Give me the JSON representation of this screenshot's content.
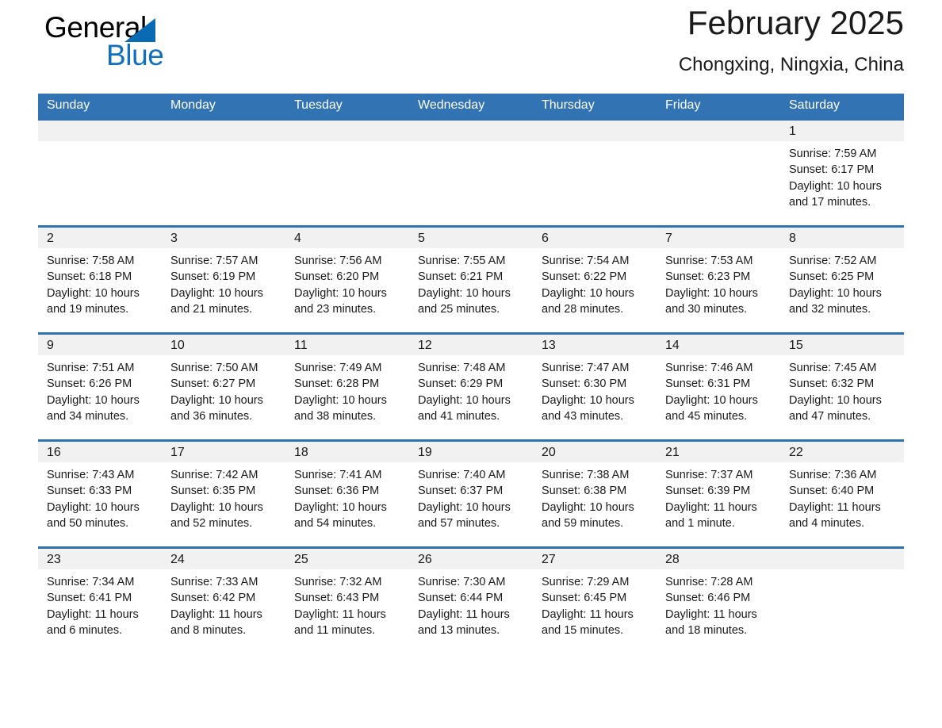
{
  "brand": {
    "name_part1": "General",
    "name_part2": "Blue",
    "triangle_color": "#0a6bb5",
    "blue_color": "#0f6fc0"
  },
  "header": {
    "title": "February 2025",
    "subtitle": "Chongxing, Ningxia, China"
  },
  "theme": {
    "header_blue": "#3273b3",
    "row_rule_blue": "#2f72b2",
    "daynum_band": "#f1f1f1"
  },
  "weekdays": [
    "Sunday",
    "Monday",
    "Tuesday",
    "Wednesday",
    "Thursday",
    "Friday",
    "Saturday"
  ],
  "weeks": [
    [
      {
        "day": "",
        "sunrise": "",
        "sunset": "",
        "daylight1": "",
        "daylight2": ""
      },
      {
        "day": "",
        "sunrise": "",
        "sunset": "",
        "daylight1": "",
        "daylight2": ""
      },
      {
        "day": "",
        "sunrise": "",
        "sunset": "",
        "daylight1": "",
        "daylight2": ""
      },
      {
        "day": "",
        "sunrise": "",
        "sunset": "",
        "daylight1": "",
        "daylight2": ""
      },
      {
        "day": "",
        "sunrise": "",
        "sunset": "",
        "daylight1": "",
        "daylight2": ""
      },
      {
        "day": "",
        "sunrise": "",
        "sunset": "",
        "daylight1": "",
        "daylight2": ""
      },
      {
        "day": "1",
        "sunrise": "Sunrise: 7:59 AM",
        "sunset": "Sunset: 6:17 PM",
        "daylight1": "Daylight: 10 hours",
        "daylight2": "and 17 minutes."
      }
    ],
    [
      {
        "day": "2",
        "sunrise": "Sunrise: 7:58 AM",
        "sunset": "Sunset: 6:18 PM",
        "daylight1": "Daylight: 10 hours",
        "daylight2": "and 19 minutes."
      },
      {
        "day": "3",
        "sunrise": "Sunrise: 7:57 AM",
        "sunset": "Sunset: 6:19 PM",
        "daylight1": "Daylight: 10 hours",
        "daylight2": "and 21 minutes."
      },
      {
        "day": "4",
        "sunrise": "Sunrise: 7:56 AM",
        "sunset": "Sunset: 6:20 PM",
        "daylight1": "Daylight: 10 hours",
        "daylight2": "and 23 minutes."
      },
      {
        "day": "5",
        "sunrise": "Sunrise: 7:55 AM",
        "sunset": "Sunset: 6:21 PM",
        "daylight1": "Daylight: 10 hours",
        "daylight2": "and 25 minutes."
      },
      {
        "day": "6",
        "sunrise": "Sunrise: 7:54 AM",
        "sunset": "Sunset: 6:22 PM",
        "daylight1": "Daylight: 10 hours",
        "daylight2": "and 28 minutes."
      },
      {
        "day": "7",
        "sunrise": "Sunrise: 7:53 AM",
        "sunset": "Sunset: 6:23 PM",
        "daylight1": "Daylight: 10 hours",
        "daylight2": "and 30 minutes."
      },
      {
        "day": "8",
        "sunrise": "Sunrise: 7:52 AM",
        "sunset": "Sunset: 6:25 PM",
        "daylight1": "Daylight: 10 hours",
        "daylight2": "and 32 minutes."
      }
    ],
    [
      {
        "day": "9",
        "sunrise": "Sunrise: 7:51 AM",
        "sunset": "Sunset: 6:26 PM",
        "daylight1": "Daylight: 10 hours",
        "daylight2": "and 34 minutes."
      },
      {
        "day": "10",
        "sunrise": "Sunrise: 7:50 AM",
        "sunset": "Sunset: 6:27 PM",
        "daylight1": "Daylight: 10 hours",
        "daylight2": "and 36 minutes."
      },
      {
        "day": "11",
        "sunrise": "Sunrise: 7:49 AM",
        "sunset": "Sunset: 6:28 PM",
        "daylight1": "Daylight: 10 hours",
        "daylight2": "and 38 minutes."
      },
      {
        "day": "12",
        "sunrise": "Sunrise: 7:48 AM",
        "sunset": "Sunset: 6:29 PM",
        "daylight1": "Daylight: 10 hours",
        "daylight2": "and 41 minutes."
      },
      {
        "day": "13",
        "sunrise": "Sunrise: 7:47 AM",
        "sunset": "Sunset: 6:30 PM",
        "daylight1": "Daylight: 10 hours",
        "daylight2": "and 43 minutes."
      },
      {
        "day": "14",
        "sunrise": "Sunrise: 7:46 AM",
        "sunset": "Sunset: 6:31 PM",
        "daylight1": "Daylight: 10 hours",
        "daylight2": "and 45 minutes."
      },
      {
        "day": "15",
        "sunrise": "Sunrise: 7:45 AM",
        "sunset": "Sunset: 6:32 PM",
        "daylight1": "Daylight: 10 hours",
        "daylight2": "and 47 minutes."
      }
    ],
    [
      {
        "day": "16",
        "sunrise": "Sunrise: 7:43 AM",
        "sunset": "Sunset: 6:33 PM",
        "daylight1": "Daylight: 10 hours",
        "daylight2": "and 50 minutes."
      },
      {
        "day": "17",
        "sunrise": "Sunrise: 7:42 AM",
        "sunset": "Sunset: 6:35 PM",
        "daylight1": "Daylight: 10 hours",
        "daylight2": "and 52 minutes."
      },
      {
        "day": "18",
        "sunrise": "Sunrise: 7:41 AM",
        "sunset": "Sunset: 6:36 PM",
        "daylight1": "Daylight: 10 hours",
        "daylight2": "and 54 minutes."
      },
      {
        "day": "19",
        "sunrise": "Sunrise: 7:40 AM",
        "sunset": "Sunset: 6:37 PM",
        "daylight1": "Daylight: 10 hours",
        "daylight2": "and 57 minutes."
      },
      {
        "day": "20",
        "sunrise": "Sunrise: 7:38 AM",
        "sunset": "Sunset: 6:38 PM",
        "daylight1": "Daylight: 10 hours",
        "daylight2": "and 59 minutes."
      },
      {
        "day": "21",
        "sunrise": "Sunrise: 7:37 AM",
        "sunset": "Sunset: 6:39 PM",
        "daylight1": "Daylight: 11 hours",
        "daylight2": "and 1 minute."
      },
      {
        "day": "22",
        "sunrise": "Sunrise: 7:36 AM",
        "sunset": "Sunset: 6:40 PM",
        "daylight1": "Daylight: 11 hours",
        "daylight2": "and 4 minutes."
      }
    ],
    [
      {
        "day": "23",
        "sunrise": "Sunrise: 7:34 AM",
        "sunset": "Sunset: 6:41 PM",
        "daylight1": "Daylight: 11 hours",
        "daylight2": "and 6 minutes."
      },
      {
        "day": "24",
        "sunrise": "Sunrise: 7:33 AM",
        "sunset": "Sunset: 6:42 PM",
        "daylight1": "Daylight: 11 hours",
        "daylight2": "and 8 minutes."
      },
      {
        "day": "25",
        "sunrise": "Sunrise: 7:32 AM",
        "sunset": "Sunset: 6:43 PM",
        "daylight1": "Daylight: 11 hours",
        "daylight2": "and 11 minutes."
      },
      {
        "day": "26",
        "sunrise": "Sunrise: 7:30 AM",
        "sunset": "Sunset: 6:44 PM",
        "daylight1": "Daylight: 11 hours",
        "daylight2": "and 13 minutes."
      },
      {
        "day": "27",
        "sunrise": "Sunrise: 7:29 AM",
        "sunset": "Sunset: 6:45 PM",
        "daylight1": "Daylight: 11 hours",
        "daylight2": "and 15 minutes."
      },
      {
        "day": "28",
        "sunrise": "Sunrise: 7:28 AM",
        "sunset": "Sunset: 6:46 PM",
        "daylight1": "Daylight: 11 hours",
        "daylight2": "and 18 minutes."
      },
      {
        "day": "",
        "sunrise": "",
        "sunset": "",
        "daylight1": "",
        "daylight2": ""
      }
    ]
  ]
}
